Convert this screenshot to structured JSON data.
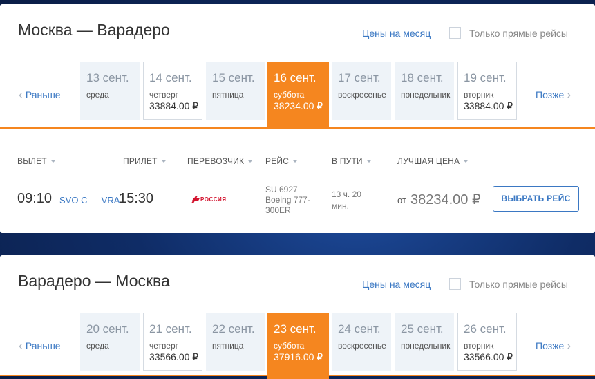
{
  "outbound": {
    "title": "Москва — Варадеро",
    "month_prices": "Цены на месяц",
    "direct_only": "Только прямые рейсы",
    "earlier": "Раньше",
    "later": "Позже",
    "days": [
      {
        "date": "13 сент.",
        "weekday": "среда",
        "price": ""
      },
      {
        "date": "14 сент.",
        "weekday": "четверг",
        "price": "33884.00 ₽"
      },
      {
        "date": "15 сент.",
        "weekday": "пятница",
        "price": ""
      },
      {
        "date": "16 сент.",
        "weekday": "суббота",
        "price": "38234.00 ₽"
      },
      {
        "date": "17 сент.",
        "weekday": "воскресенье",
        "price": ""
      },
      {
        "date": "18 сент.",
        "weekday": "понедельник",
        "price": ""
      },
      {
        "date": "19 сент.",
        "weekday": "вторник",
        "price": "33884.00 ₽"
      }
    ]
  },
  "results": {
    "headers": {
      "departure": "ВЫЛЕТ",
      "arrival": "ПРИЛЕТ",
      "carrier": "ПЕРЕВОЗЧИК",
      "flight": "РЕЙС",
      "duration": "В ПУТИ",
      "best_price": "ЛУЧШАЯ ЦЕНА"
    },
    "flight": {
      "dep_time": "09:10",
      "route": "SVO C — VRA",
      "arr_time": "15:30",
      "airline": "РОССИЯ",
      "number": "SU 6927",
      "aircraft": "Boeing 777-300ER",
      "duration": "13 ч. 20 мин.",
      "price_prefix": "от",
      "price": "38234.00 ₽",
      "select_label": "ВЫБРАТЬ РЕЙС"
    }
  },
  "inbound": {
    "title": "Варадеро — Москва",
    "month_prices": "Цены на месяц",
    "direct_only": "Только прямые рейсы",
    "earlier": "Раньше",
    "later": "Позже",
    "days": [
      {
        "date": "20 сент.",
        "weekday": "среда",
        "price": ""
      },
      {
        "date": "21 сент.",
        "weekday": "четверг",
        "price": "33566.00 ₽"
      },
      {
        "date": "22 сент.",
        "weekday": "пятница",
        "price": ""
      },
      {
        "date": "23 сент.",
        "weekday": "суббота",
        "price": "37916.00 ₽"
      },
      {
        "date": "24 сент.",
        "weekday": "воскресенье",
        "price": ""
      },
      {
        "date": "25 сент.",
        "weekday": "понедельник",
        "price": ""
      },
      {
        "date": "26 сент.",
        "weekday": "вторник",
        "price": "33566.00 ₽"
      }
    ]
  },
  "colors": {
    "accent": "#f5861f",
    "link": "#3b78c3",
    "airline": "#d3122d",
    "background": "#0f2c66"
  },
  "icons": {
    "prev": "chevron-left-icon",
    "next": "chevron-right-icon",
    "sort": "sort-caret-icon",
    "airline": "aeroflot-logo-icon"
  }
}
